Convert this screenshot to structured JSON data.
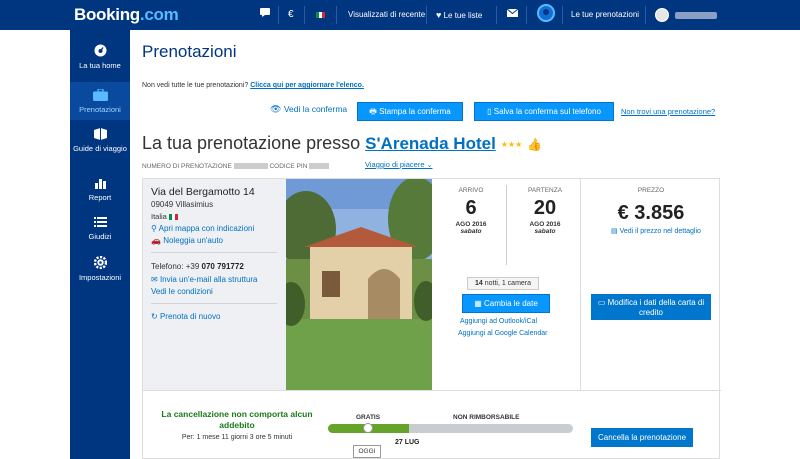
{
  "topbar": {
    "logo_main": "Booking",
    "logo_suffix": ".com",
    "currency": "€",
    "recently_viewed": "Visualizzati di recente",
    "wishlists": "Le tue liste",
    "my_bookings": "Le tue prenotazioni"
  },
  "sidebar": {
    "items": [
      {
        "label": "La tua home",
        "icon": "dashboard-icon"
      },
      {
        "label": "Prenotazioni",
        "icon": "suitcase-icon"
      },
      {
        "label": "Guide di viaggio",
        "icon": "book-icon"
      },
      {
        "label": "Report",
        "icon": "bar-chart-icon"
      },
      {
        "label": "Giudizi",
        "icon": "list-icon"
      },
      {
        "label": "Impostazioni",
        "icon": "gear-icon"
      }
    ]
  },
  "main": {
    "title": "Prenotazioni",
    "not_see_text": "Non vedi tutte le tue prenotazioni?",
    "not_see_link": "Clicca qui per aggiornare l'elenco.",
    "view_confirmation": "Vedi la conferma",
    "print_confirmation": "Stampa la conferma",
    "save_phone": "Salva la conferma sul telefono",
    "lost_booking": "Non trovi una prenotazione?",
    "hotel_prefix": "La tua prenotazione presso",
    "hotel_name": "S'Arenada Hotel",
    "booking_no_label": "NUMERO DI PRENOTAZIONE",
    "pin_label": "CODICE PIN",
    "trip_type": "Viaggio di piacere"
  },
  "address": {
    "street": "Via del Bergamotto 14",
    "zip_city": "09049 Villasimius",
    "country": "Italia",
    "open_map": "Apri mappa con indicazioni",
    "rent_car": "Noleggia un'auto",
    "phone_label": "Telefono: +39",
    "phone_number": "070 791772",
    "email_link": "Invia un'e-mail alla struttura",
    "conditions": "Vedi le condizioni",
    "rebook": "Prenota di nuovo"
  },
  "dates": {
    "checkin_label": "ARRIVO",
    "checkin_day": "6",
    "checkin_month": "AGO 2016",
    "checkin_weekday": "sabato",
    "checkout_label": "PARTENZA",
    "checkout_day": "20",
    "checkout_month": "AGO 2016",
    "checkout_weekday": "sabato",
    "nights_bold": "14",
    "nights_rest": "notti, 1 camera",
    "change_dates": "Cambia le date",
    "outlook": "Aggiungi ad Outlook/iCal",
    "google": "Aggiungi al Google Calendar"
  },
  "price": {
    "label": "PREZZO",
    "amount": "€ 3.856",
    "detail": "Vedi il prezzo nel dettaglio",
    "edit_card": "Modifica i dati della carta di credito"
  },
  "cancellation": {
    "title": "La cancellazione non comporta alcun addebito",
    "remaining": "Per: 1 mese 11 giorni 3 ore 5 minuti",
    "free_label": "GRATIS",
    "nonrefund_label": "NON RIMBORSABILE",
    "today": "OGGI",
    "deadline": "27 LUG",
    "free_fraction": 0.33,
    "cancel_button": "Cancella la prenotazione"
  },
  "colors": {
    "brand_dark": "#003580",
    "brand_button": "#0896ff",
    "link": "#0071c2",
    "green": "#66a329",
    "star": "#febb02"
  }
}
